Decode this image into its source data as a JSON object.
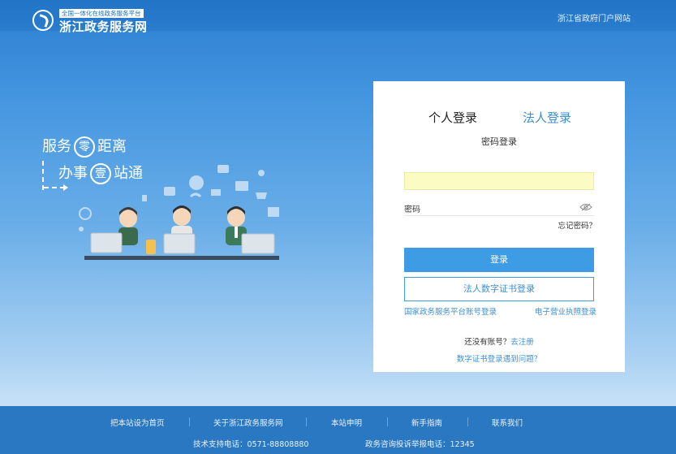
{
  "header": {
    "logo_tagline": "全国一体化在线政务服务平台",
    "logo_name": "浙江政务服务网",
    "portal_link": "浙江省政府门户网站"
  },
  "hero": {
    "slogan_line1_a": "服务",
    "slogan_line1_circle": "零",
    "slogan_line1_b": "距离",
    "slogan_line2_a": "办事",
    "slogan_line2_circle": "壹",
    "slogan_line2_b": "站通"
  },
  "login": {
    "tab_personal": "个人登录",
    "tab_legal": "法人登录",
    "subtitle": "密码登录",
    "username_value": "",
    "password_label": "密码",
    "forgot_password": "忘记密码？",
    "login_button": "登录",
    "cert_login_button": "法人数字证书登录",
    "national_platform_login": "国家政务服务平台账号登录",
    "business_license_login": "电子营业执照登录",
    "no_account_text": "还没有账号？",
    "register_link": "去注册",
    "cert_issue_link": "数字证书登录遇到问题？"
  },
  "footer": {
    "links": [
      "把本站设为首页",
      "关于浙江政务服务网",
      "本站申明",
      "新手指南",
      "联系我们"
    ],
    "tech_support": "技术支持电话：0571-88808880",
    "complaint_hotline": "政务咨询投诉举报电话：12345"
  },
  "colors": {
    "accent": "#3d9ce3",
    "header_bg": "#2274c7",
    "footer_bg": "#2b78c2",
    "username_field_bg": "#fbfcc4"
  }
}
